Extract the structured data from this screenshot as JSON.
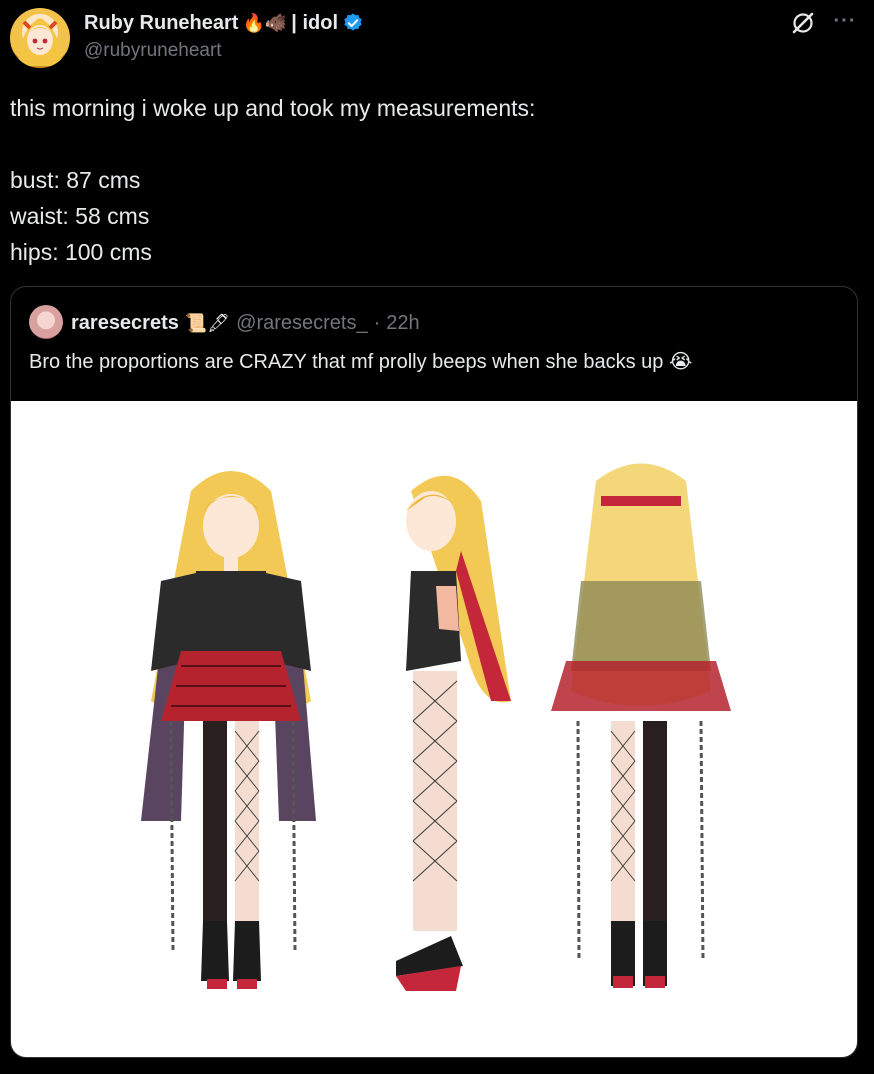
{
  "tweet": {
    "author": {
      "name": "Ruby Runeheart",
      "badges": "🔥🐗",
      "suffix": "| idol",
      "handle": "@rubyruneheart",
      "verified_icon": "verified-badge-icon"
    },
    "actions": {
      "grok_icon": "grok-icon",
      "more_label": "···"
    },
    "text_lines": [
      "this morning i woke up and took my measurements:",
      "bust: 87 cms",
      "waist: 58 cms",
      "hips: 100 cms"
    ]
  },
  "quote": {
    "name": "raresecrets",
    "name_emojis": "📜🖋",
    "handle": "@raresecrets_",
    "separator": "·",
    "time": "22h",
    "text": "Bro the proportions are CRAZY that mf prolly beeps when she backs up",
    "text_emoji": "😭",
    "media_description_icon": "character-reference-sheet-image"
  },
  "colors": {
    "background": "#000000",
    "text": "#e7e9ea",
    "secondary": "#71767b",
    "border": "#2f3336",
    "verified": "#1d9bf0"
  }
}
